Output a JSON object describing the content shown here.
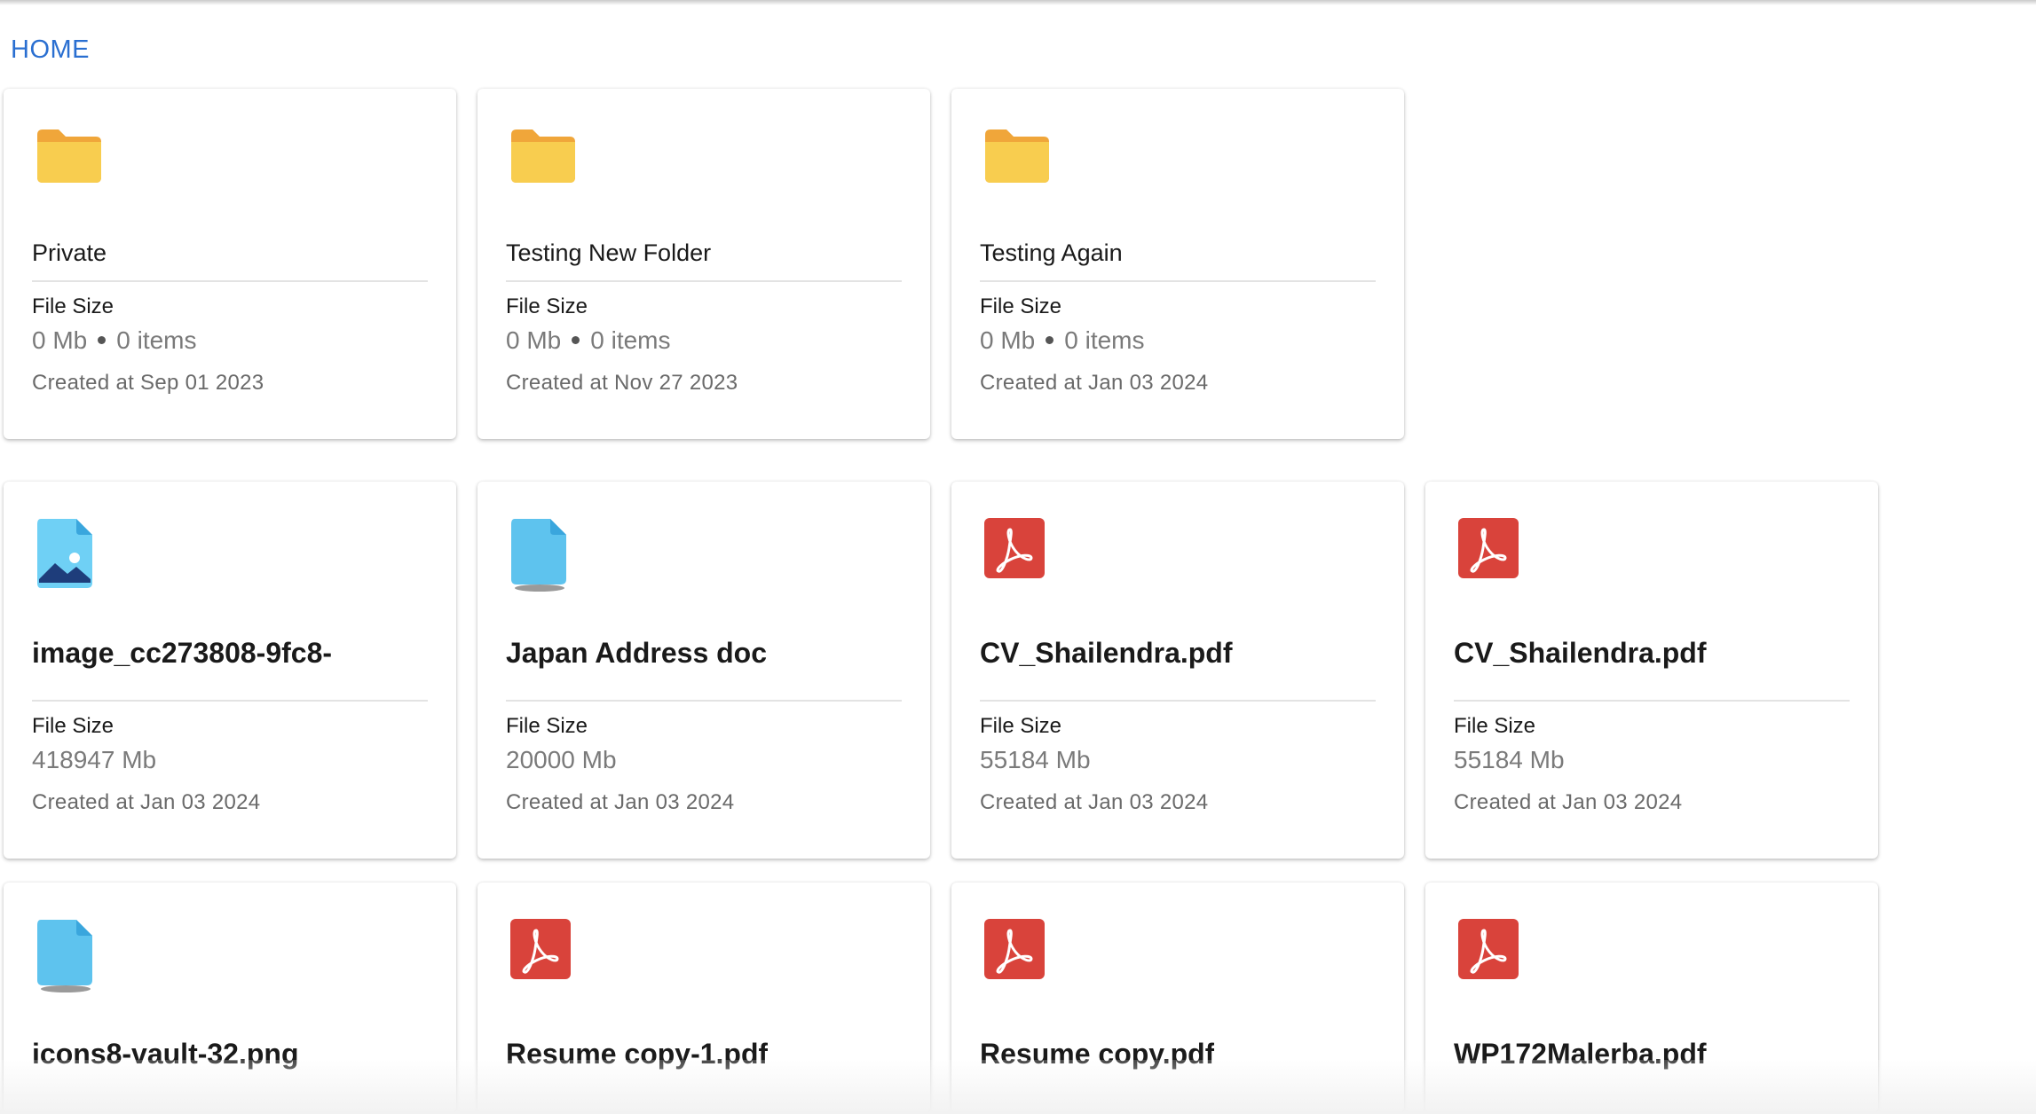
{
  "breadcrumb": {
    "home": "HOME"
  },
  "labels": {
    "file_size": "File Size"
  },
  "folders": [
    {
      "name": "Private",
      "size": "0 Mb",
      "items": "0 items",
      "created": "Created at Sep 01 2023",
      "icon": "folder-icon"
    },
    {
      "name": "Testing New Folder",
      "size": "0 Mb",
      "items": "0 items",
      "created": "Created at Nov 27 2023",
      "icon": "folder-icon"
    },
    {
      "name": "Testing Again",
      "size": "0 Mb",
      "items": "0 items",
      "created": "Created at Jan 03 2024",
      "icon": "folder-icon"
    }
  ],
  "files": [
    {
      "name": "image_cc273808-9fc8-",
      "size": "418947 Mb",
      "created": "Created at Jan 03 2024",
      "icon": "image-file-icon"
    },
    {
      "name": "Japan Address doc",
      "size": "20000 Mb",
      "created": "Created at Jan 03 2024",
      "icon": "document-file-icon"
    },
    {
      "name": "CV_Shailendra.pdf",
      "size": "55184 Mb",
      "created": "Created at Jan 03 2024",
      "icon": "pdf-file-icon"
    },
    {
      "name": "CV_Shailendra.pdf",
      "size": "55184 Mb",
      "created": "Created at Jan 03 2024",
      "icon": "pdf-file-icon"
    },
    {
      "name": "icons8-vault-32.png",
      "icon": "document-file-icon"
    },
    {
      "name": "Resume copy-1.pdf",
      "icon": "pdf-file-icon"
    },
    {
      "name": "Resume copy.pdf",
      "icon": "pdf-file-icon"
    },
    {
      "name": "WP172Malerba.pdf",
      "icon": "pdf-file-icon"
    }
  ],
  "colors": {
    "link": "#2a6fd1",
    "folder": "#f8cd4f",
    "folder_tab": "#f0a63a",
    "pdf": "#d9433b",
    "doc": "#5ec3ee"
  }
}
